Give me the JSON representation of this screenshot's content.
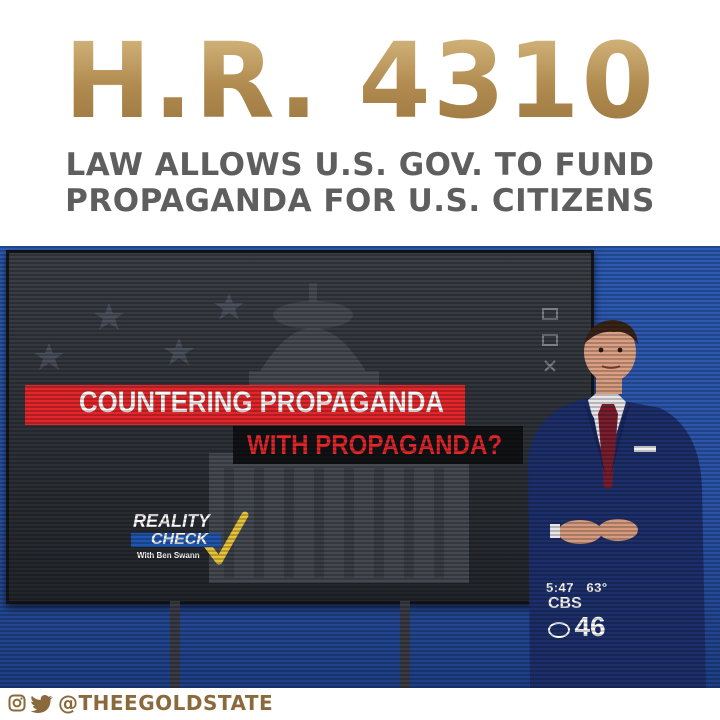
{
  "headline": "H.R. 4310",
  "subheadline": {
    "line1": "LAW ALLOWS U.S. GOV. TO FUND",
    "line2": "PROPAGANDA FOR U.S. CITIZENS"
  },
  "broadcast": {
    "banner_line1": "COUNTERING PROPAGANDA",
    "banner_line2": "WITH PROPAGANDA?",
    "logo": {
      "word1": "REALITY",
      "word2": "CHECK",
      "byline": "With Ben Swann"
    },
    "time": "5:47",
    "temperature": "63°",
    "station_call": "CBS",
    "station_number": "46"
  },
  "footer": {
    "handle": "@THEEGOLDSTATE",
    "icons": [
      "instagram-icon",
      "twitter-icon"
    ]
  },
  "colors": {
    "gold": "#b8975a",
    "subtitle_gray": "#5e5e5e",
    "banner_red": "#e3262a",
    "studio_blue": "#2d5bb4",
    "handle_gold": "#8a6a3c"
  }
}
